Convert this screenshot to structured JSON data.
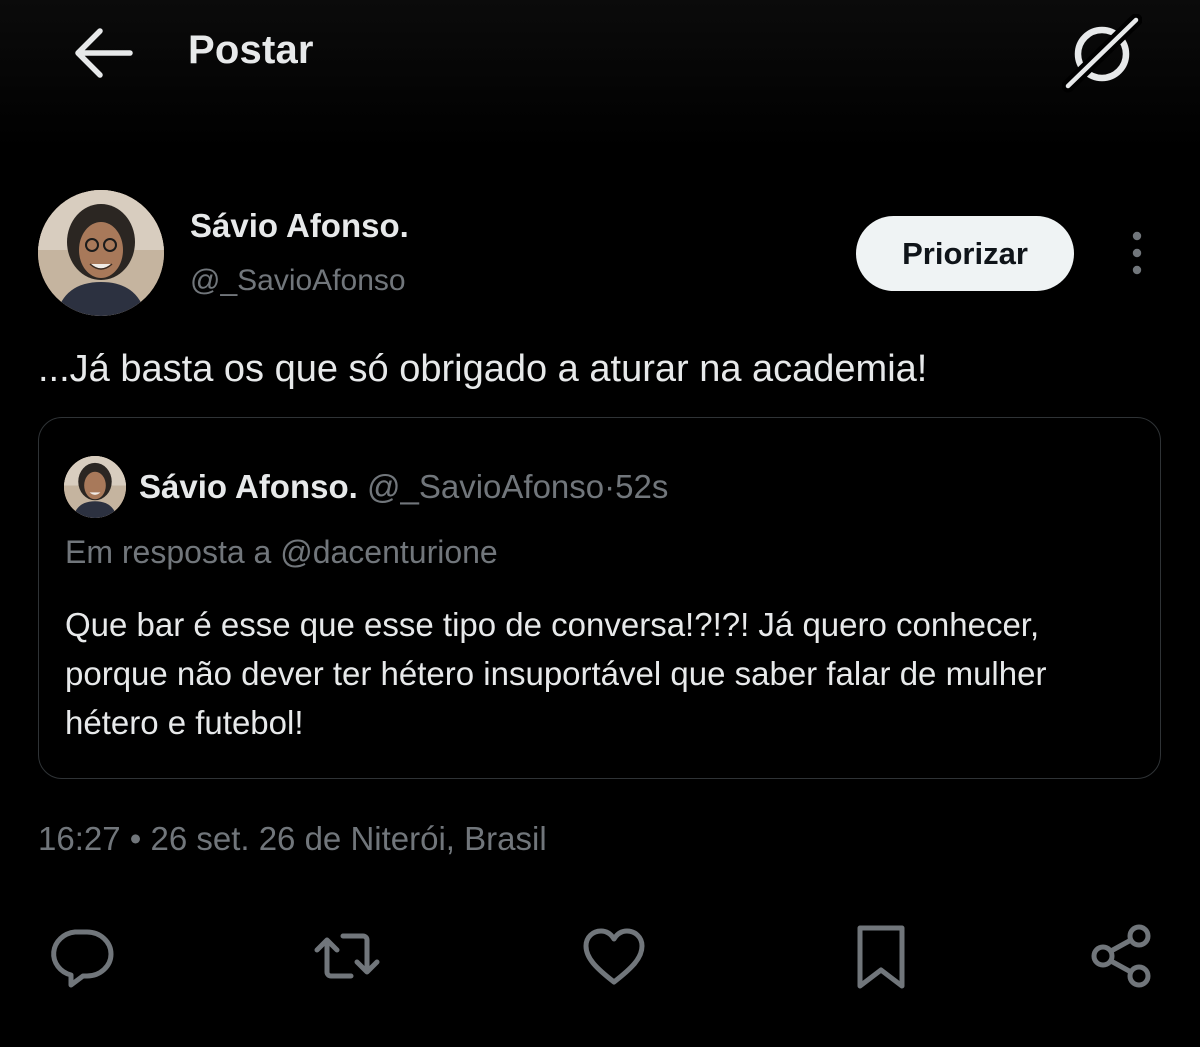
{
  "header": {
    "title": "Postar",
    "back_icon": "arrow-left-icon",
    "grok_icon": "grok-icon"
  },
  "post": {
    "author_name": "Sávio Afonso.",
    "author_handle": "@_SavioAfonso",
    "priorizar_label": "Priorizar",
    "text": "...Já basta os que só obrigado a aturar na academia!",
    "meta": "16:27 • 26 set. 26 de Niterói, Brasil"
  },
  "quote": {
    "author_name": "Sávio Afonso.",
    "author_handle": "@_SavioAfonso",
    "separator": "·",
    "time": "52s",
    "reply_to": "Em resposta a @dacenturione",
    "text": "Que bar é esse que esse tipo de conversa!?!?! Já quero conhecer, porque não dever ter hétero insuportável que saber falar de mulher hétero e futebol!"
  },
  "actions": [
    {
      "name": "reply",
      "icon": "reply-icon"
    },
    {
      "name": "repost",
      "icon": "repost-icon"
    },
    {
      "name": "like",
      "icon": "heart-icon"
    },
    {
      "name": "bookmark",
      "icon": "bookmark-icon"
    },
    {
      "name": "share",
      "icon": "share-icon"
    }
  ],
  "colors": {
    "background": "#000000",
    "text_primary": "#e7e9ea",
    "text_secondary": "#71767b",
    "border": "#2f3336",
    "button_bg": "#eff3f4"
  }
}
